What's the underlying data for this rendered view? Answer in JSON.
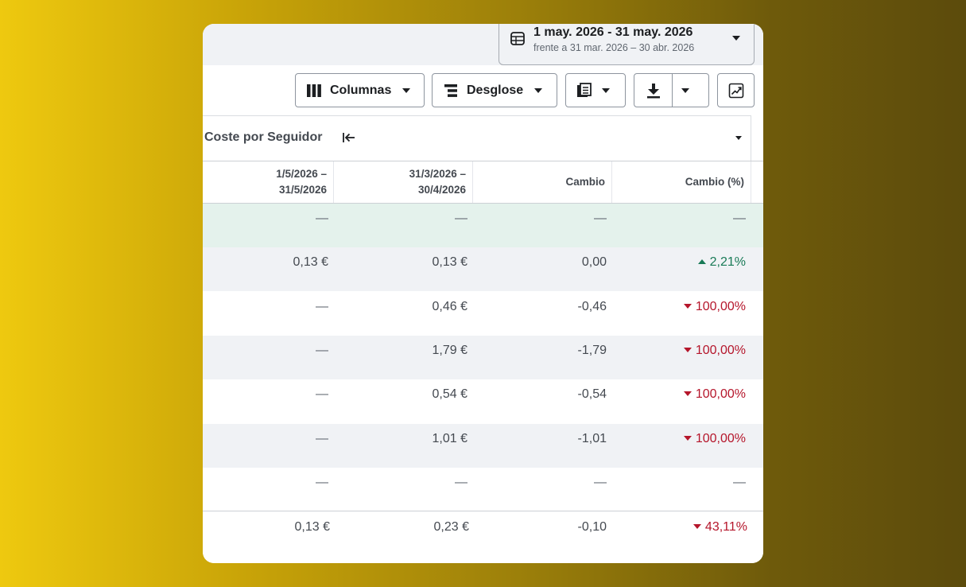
{
  "date_range": {
    "main": "1 may. 2026 - 31 may. 2026",
    "compare": "frente a 31 mar. 2026 – 30 abr. 2026",
    "icon": "calendar-table-icon"
  },
  "toolbar": {
    "columns_label": "Columnas",
    "breakdown_label": "Desglose",
    "columns_icon": "columns-icon",
    "breakdown_icon": "breakdown-icon",
    "reports_icon": "reports-icon",
    "export_icon": "download-icon",
    "chart_icon": "trend-chart-icon"
  },
  "metric_header": {
    "title": "Coste por Seguidor",
    "icon": "collapse-left-icon"
  },
  "columns": [
    {
      "line1": "1/5/2026 –",
      "line2": "31/5/2026"
    },
    {
      "line1": "31/3/2026 –",
      "line2": "30/4/2026"
    },
    {
      "line1": "Cambio",
      "line2": ""
    },
    {
      "line1": "Cambio (%)",
      "line2": ""
    }
  ],
  "rows": [
    {
      "bg": "#e4f2ec",
      "current": "—",
      "previous": "—",
      "change": "—",
      "pct": "—",
      "trend": "none"
    },
    {
      "bg": "#f0f2f5",
      "current": "0,13 €",
      "previous": "0,13 €",
      "change": "0,00",
      "pct": "2,21%",
      "trend": "up"
    },
    {
      "bg": "#ffffff",
      "current": "—",
      "previous": "0,46 €",
      "change": "-0,46",
      "pct": "100,00%",
      "trend": "down"
    },
    {
      "bg": "#f0f2f5",
      "current": "—",
      "previous": "1,79 €",
      "change": "-1,79",
      "pct": "100,00%",
      "trend": "down"
    },
    {
      "bg": "#ffffff",
      "current": "—",
      "previous": "0,54 €",
      "change": "-0,54",
      "pct": "100,00%",
      "trend": "down"
    },
    {
      "bg": "#f0f2f5",
      "current": "—",
      "previous": "1,01 €",
      "change": "-1,01",
      "pct": "100,00%",
      "trend": "down"
    },
    {
      "bg": "#ffffff",
      "current": "—",
      "previous": "—",
      "change": "—",
      "pct": "—",
      "trend": "none"
    }
  ],
  "totals": {
    "current": "0,13 €",
    "previous": "0,23 €",
    "change": "-0,10",
    "pct": "43,11%",
    "trend": "down"
  },
  "colors": {
    "positive": "#187a56",
    "negative": "#b5162b",
    "highlight_row": "#e4f2ec"
  }
}
